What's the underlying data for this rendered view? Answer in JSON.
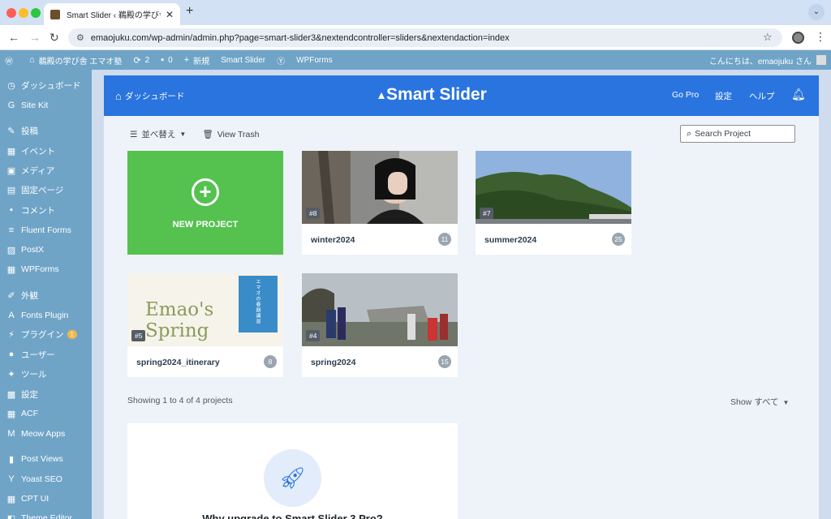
{
  "browser": {
    "tab_title": "Smart Slider ‹ 鵜殿の学び舎 エマオ塾",
    "url": "emaojuku.com/wp-admin/admin.php?page=smart-slider3&nextendcontroller=sliders&nextendaction=index",
    "traffic_colors": [
      "#ff5f57",
      "#febc2e",
      "#28c840"
    ]
  },
  "wpbar": {
    "site": "鵜殿の学び舎 エマオ塾",
    "updates": "2",
    "comments": "0",
    "new": "新規",
    "smart_slider": "Smart Slider",
    "wpforms": "WPForms",
    "greeting": "こんにちは、emaojuku さん"
  },
  "sidebar": {
    "items": [
      {
        "icon": "dashboard-icon",
        "glyph": "◷",
        "label": "ダッシュボード"
      },
      {
        "icon": "sitekit-icon",
        "glyph": "G",
        "label": "Site Kit"
      },
      {
        "icon": "pin-icon",
        "glyph": "✎",
        "label": "投稿"
      },
      {
        "icon": "calendar-icon",
        "glyph": "▦",
        "label": "イベント"
      },
      {
        "icon": "media-icon",
        "glyph": "▣",
        "label": "メディア"
      },
      {
        "icon": "page-icon",
        "glyph": "▤",
        "label": "固定ページ"
      },
      {
        "icon": "comment-icon",
        "glyph": "▪",
        "label": "コメント"
      },
      {
        "icon": "forms-icon",
        "glyph": "≡",
        "label": "Fluent Forms"
      },
      {
        "icon": "postx-icon",
        "glyph": "▨",
        "label": "PostX"
      },
      {
        "icon": "wpforms-icon",
        "glyph": "▦",
        "label": "WPForms"
      },
      {
        "icon": "appearance-icon",
        "glyph": "✐",
        "label": "外観"
      },
      {
        "icon": "fonts-icon",
        "glyph": "A",
        "label": "Fonts Plugin"
      },
      {
        "icon": "plugin-icon",
        "glyph": "⚡",
        "label": "プラグイン",
        "badge": "1"
      },
      {
        "icon": "user-icon",
        "glyph": "●",
        "label": "ユーザー"
      },
      {
        "icon": "tools-icon",
        "glyph": "✦",
        "label": "ツール"
      },
      {
        "icon": "settings-icon",
        "glyph": "▩",
        "label": "設定"
      },
      {
        "icon": "acf-icon",
        "glyph": "▦",
        "label": "ACF"
      },
      {
        "icon": "meow-icon",
        "glyph": "M",
        "label": "Meow Apps"
      },
      {
        "icon": "chart-icon",
        "glyph": "▮",
        "label": "Post Views"
      },
      {
        "icon": "yoast-icon",
        "glyph": "Y",
        "label": "Yoast SEO"
      },
      {
        "icon": "cpt-icon",
        "glyph": "▦",
        "label": "CPT UI"
      },
      {
        "icon": "theme-editor-icon",
        "glyph": "◧",
        "label": "Theme Editor"
      }
    ]
  },
  "header": {
    "dashboard": "ダッシュボード",
    "logo": "Smart Slider",
    "gopro": "Go Pro",
    "settings": "設定",
    "help": "ヘルプ"
  },
  "toolbar": {
    "sort": "並べ替え",
    "trash": "View Trash",
    "search_placeholder": "Search Project"
  },
  "new_project": "NEW PROJECT",
  "projects": [
    {
      "id": "#8",
      "name": "winter2024",
      "count": "11"
    },
    {
      "id": "#7",
      "name": "summer2024",
      "count": "25"
    },
    {
      "id": "#5",
      "name": "spring2024_itinerary",
      "count": "8",
      "thumb_text": "Emao's Spring",
      "thumb_vertical": "エマオの春期講習"
    },
    {
      "id": "#4",
      "name": "spring2024",
      "count": "15"
    }
  ],
  "footer": {
    "showing": "Showing 1 to 4 of 4 projects",
    "show": "Show",
    "show_value": "すべて"
  },
  "promo": {
    "title": "Why upgrade to Smart Slider 3 Pro?"
  }
}
